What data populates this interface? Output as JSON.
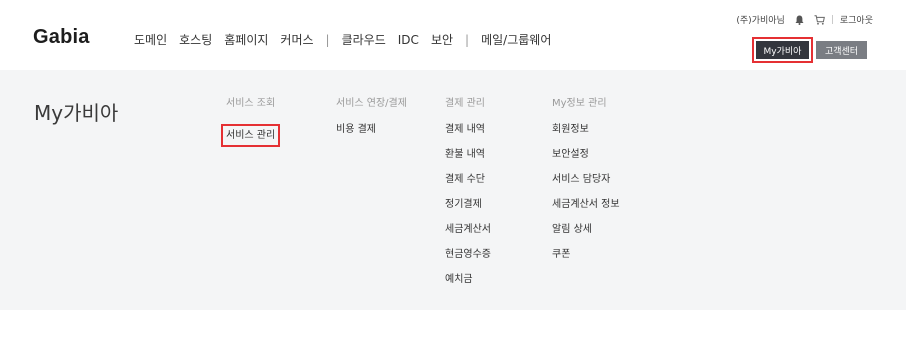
{
  "header": {
    "logo": "Gabia",
    "nav": [
      "도메인",
      "호스팅",
      "홈페이지",
      "커머스",
      "|",
      "클라우드",
      "IDC",
      "보안",
      "|",
      "메일/그룹웨어"
    ],
    "user_greeting": "(주)가비아님",
    "logout": "로그아웃",
    "my_gabia_button": "My가비아",
    "customer_center_button": "고객센터"
  },
  "panel": {
    "title": "My가비아",
    "columns": [
      {
        "heading": "서비스 조회",
        "items": [
          "서비스 관리"
        ]
      },
      {
        "heading": "서비스 연장/결제",
        "items": [
          "비용 결제"
        ]
      },
      {
        "heading": "결제 관리",
        "items": [
          "결제 내역",
          "환불 내역",
          "결제 수단",
          "정기결제",
          "세금계산서",
          "현금영수증",
          "예치금"
        ]
      },
      {
        "heading": "My정보 관리",
        "items": [
          "회원정보",
          "보안설정",
          "서비스 담당자",
          "세금계산서 정보",
          "알림 상세",
          "쿠폰"
        ]
      }
    ]
  },
  "colors": {
    "highlight": "#e53033",
    "dark_button": "#33363d",
    "gray_button": "#7a7d83",
    "panel_bg": "#f4f5f6"
  },
  "icons": [
    "bell-icon",
    "cart-icon"
  ]
}
